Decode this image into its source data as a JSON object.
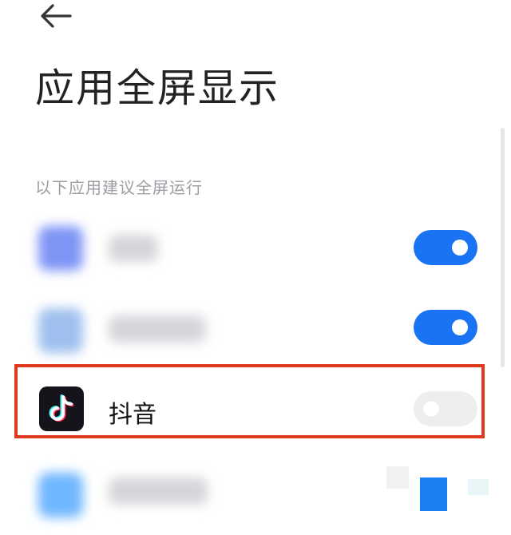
{
  "header": {
    "back_icon": "arrow-left-icon",
    "title": "应用全屏显示"
  },
  "section": {
    "label": "以下应用建议全屏运行"
  },
  "apps": [
    {
      "name": "",
      "name_visible": false,
      "icon_color": "#7f95f6",
      "toggle_on": true
    },
    {
      "name": "",
      "name_visible": false,
      "icon_color": "#9fc0ee",
      "toggle_on": true
    },
    {
      "name": "抖音",
      "name_visible": true,
      "icon": "tiktok-icon",
      "toggle_on": false
    },
    {
      "name": "",
      "name_visible": false,
      "icon_color": "#6fb7ff",
      "toggle_on": null
    }
  ],
  "colors": {
    "toggle_on": "#1a73f2",
    "toggle_off": "#eeeeee",
    "highlight_border": "#e03a1e",
    "title_text": "#222222",
    "section_text": "#9b9ea3"
  }
}
